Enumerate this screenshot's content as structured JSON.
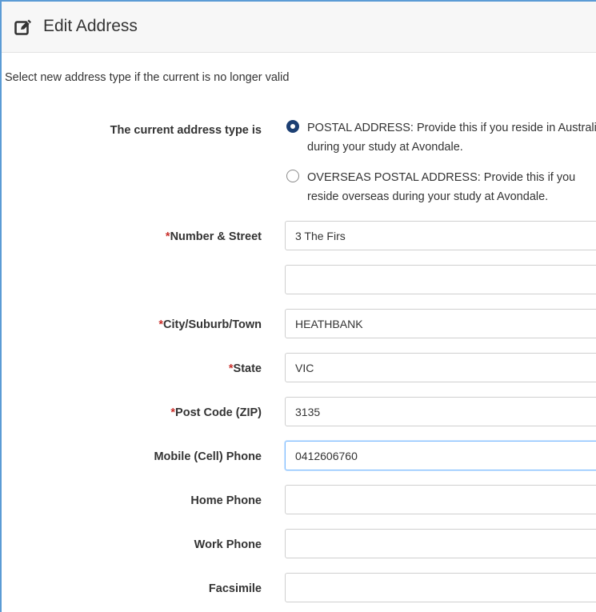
{
  "header": {
    "title": "Edit Address",
    "icon": "edit-icon"
  },
  "intro": "Select new address type if the current is no longer valid",
  "address_type": {
    "label": "The current address type is",
    "options": [
      {
        "text": "POSTAL ADDRESS: Provide this if you reside in Australia during your study at Avondale.",
        "selected": true
      },
      {
        "text": "OVERSEAS POSTAL ADDRESS: Provide this if you reside overseas during your study at Avondale.",
        "selected": false
      }
    ]
  },
  "fields": {
    "street": {
      "required_mark": "*",
      "label": "Number & Street",
      "value": "3 The Firs",
      "value2": ""
    },
    "city": {
      "required_mark": "*",
      "label": "City/Suburb/Town",
      "value": "HEATHBANK"
    },
    "state": {
      "required_mark": "*",
      "label": "State",
      "value": "VIC"
    },
    "postcode": {
      "required_mark": "*",
      "label": "Post Code (ZIP)",
      "value": "3135"
    },
    "mobile": {
      "label": "Mobile (Cell) Phone",
      "value": "0412606760"
    },
    "home": {
      "label": "Home Phone",
      "value": ""
    },
    "work": {
      "label": "Work Phone",
      "value": ""
    },
    "fax": {
      "label": "Facsimile",
      "value": ""
    }
  },
  "colors": {
    "accent": "#1c3f73",
    "required": "#c9302c",
    "frame": "#5b9bd5"
  }
}
